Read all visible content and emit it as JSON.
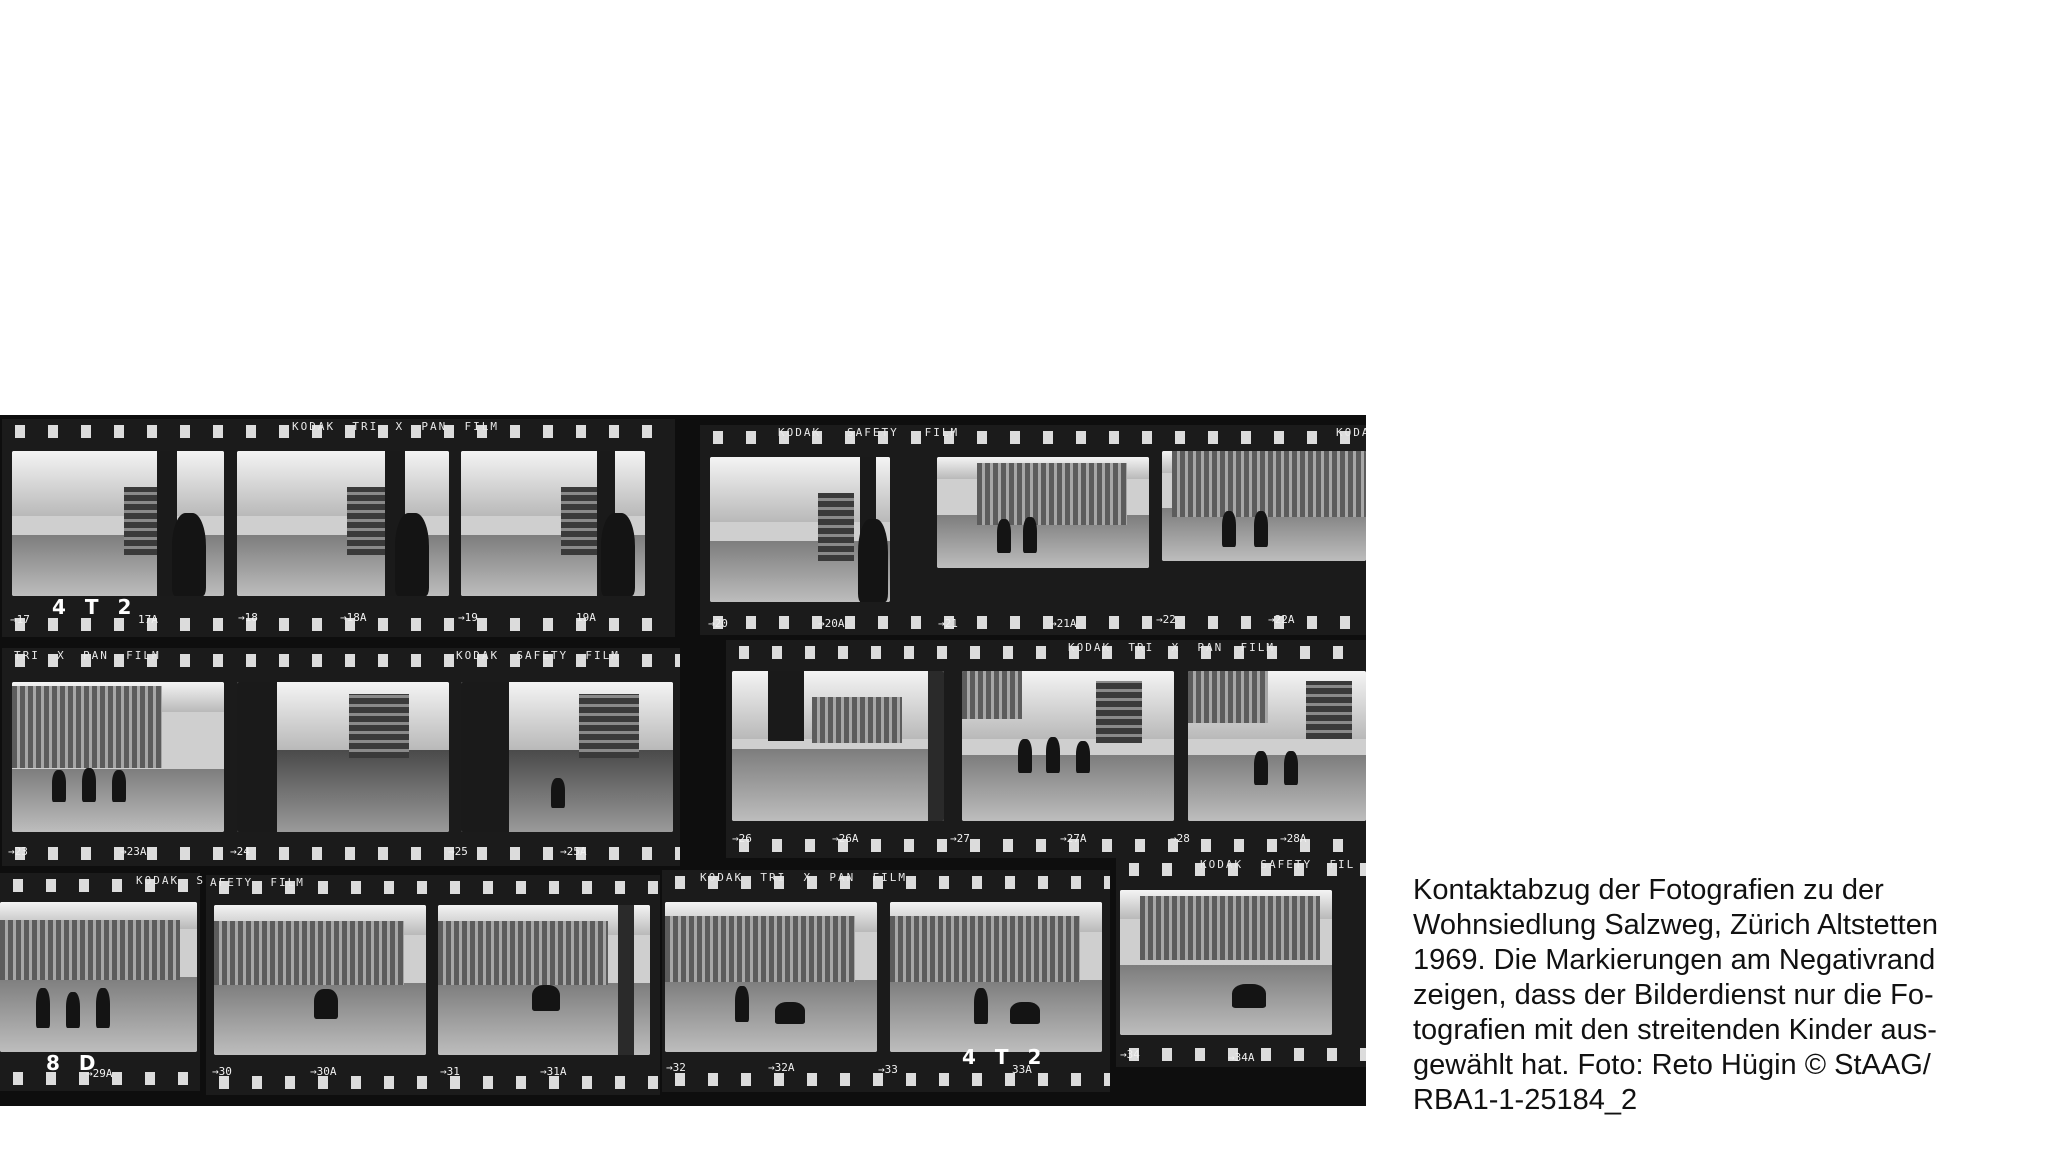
{
  "contact_sheet": {
    "film_brands": {
      "row1_left": "KODAK  TRI  X  PAN  FILM",
      "row1_mid": "KODAK   SAFETY   FILM",
      "row1_right": "KODA",
      "row2_left": "TRI  X  PAN  FILM",
      "row2_mid": "KODAK  SAFETY  FILM",
      "row2_right": "KODAK  TRI  X  PAN  FILM",
      "row3_left": "KODAK  S",
      "row3_left2": "AFETY  FILM",
      "row3_mid": "KODAK  TRI  X  PAN  FILM",
      "row3_right": "KODAK  SAFETY  FIL"
    },
    "frame_numbers": {
      "n17": "→17",
      "n17a": "17A",
      "n18": "→18",
      "n18a": "→18A",
      "n19": "→19",
      "n19a": "19A",
      "n20": "→20",
      "n20a": "→20A",
      "n21": "→21",
      "n21a": "→21A",
      "n22": "→22",
      "n22a": "→22A",
      "n23": "→23",
      "n23a": "→23A",
      "n24": "→24",
      "n25": "→25",
      "n25a": "→25A",
      "n26": "→26",
      "n26a": "→26A",
      "n27": "→27",
      "n27a": "→27A",
      "n28": "→28",
      "n28a": "→28A",
      "n29a": "→29A",
      "n30": "→30",
      "n30a": "→30A",
      "n31": "→31",
      "n31a": "→31A",
      "n32": "→32",
      "n32a": "→32A",
      "n33": "→33",
      "n33a": "33A",
      "n34": "→34",
      "n34a": "→34A"
    },
    "handwritten_marks": {
      "m1": "4 T 2",
      "m2": "8 D",
      "m3": "4 T 2"
    }
  },
  "caption": {
    "lines": [
      "Kontaktabzug der Fotografien zu der",
      "Wohnsiedlung Salzweg, Zürich Altstetten",
      "1969. Die Markierungen am Negativrand",
      "zeigen, dass der Bilderdienst nur die Fo-",
      "tografien mit den streitenden Kinder aus-",
      "gewählt hat. Foto: Reto Hügin © StAAG/",
      "RBA1-1-25184_2"
    ]
  }
}
